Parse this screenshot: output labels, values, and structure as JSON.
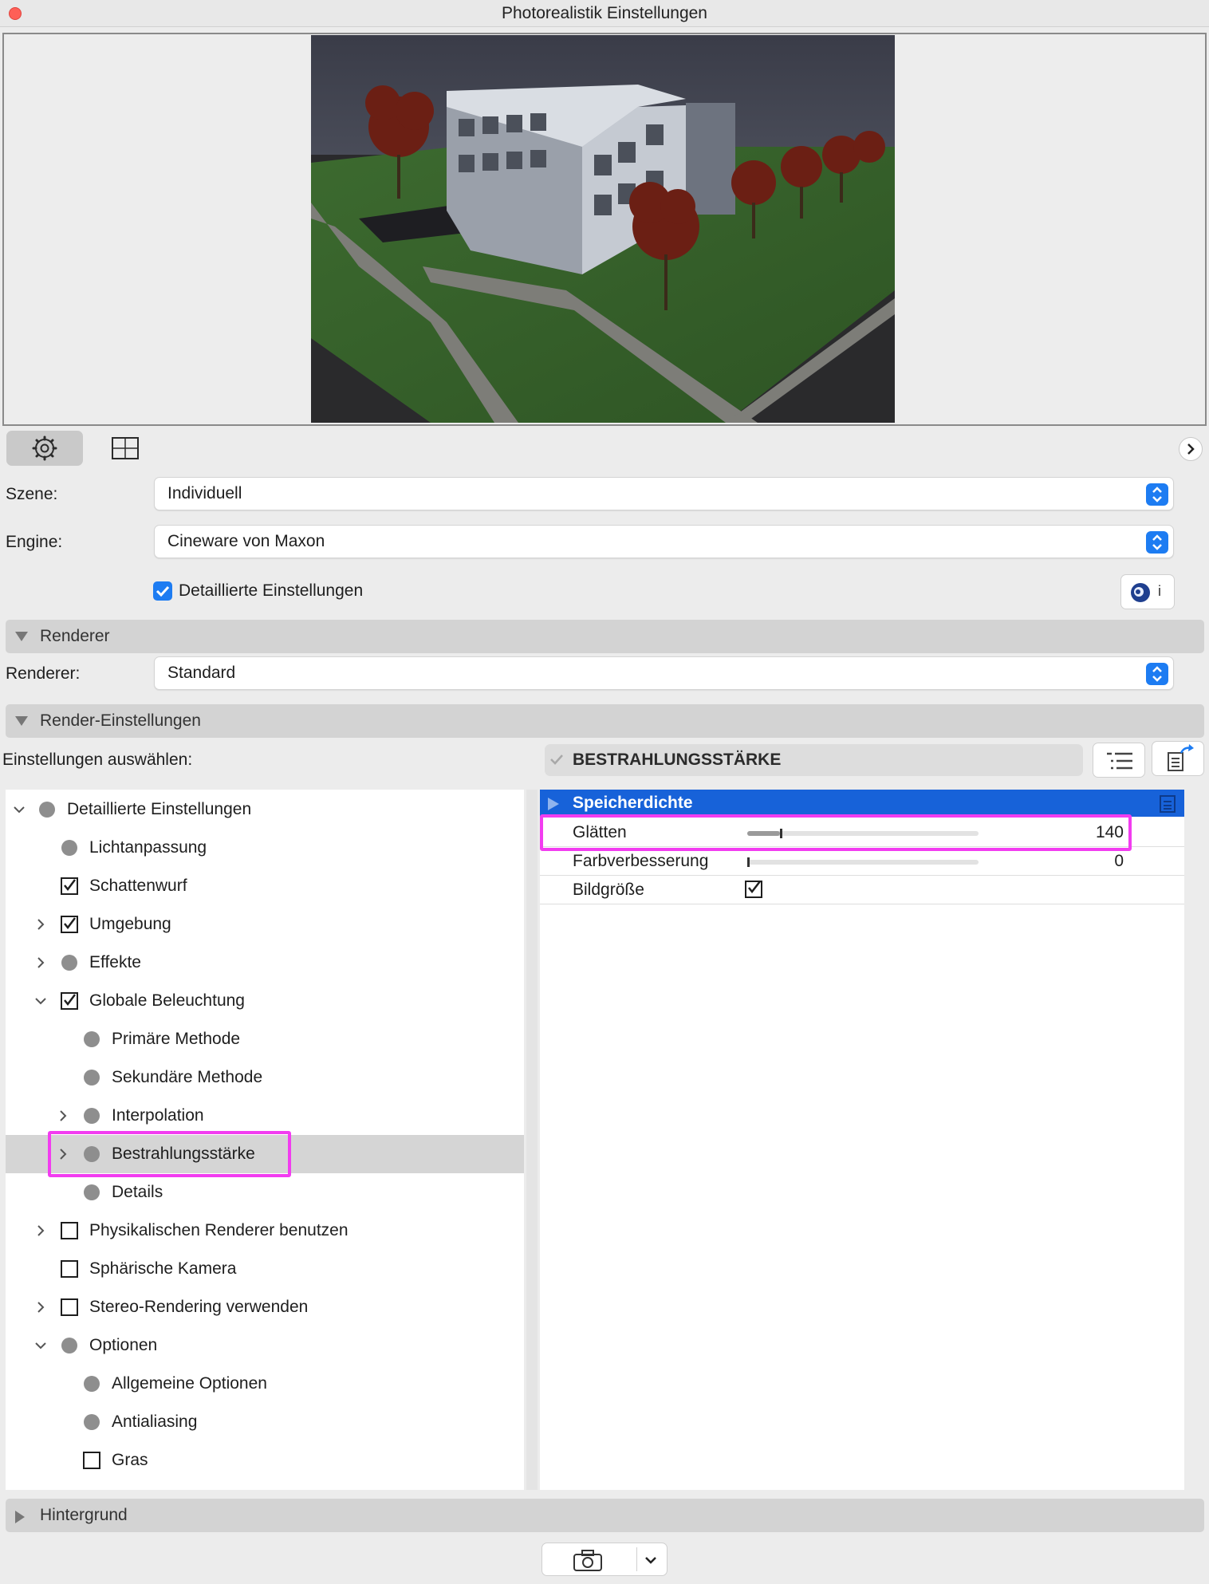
{
  "window": {
    "title": "Photorealistik Einstellungen"
  },
  "form": {
    "scene_label": "Szene:",
    "scene_value": "Individuell",
    "engine_label": "Engine:",
    "engine_value": "Cineware von Maxon",
    "detailed_label": "Detaillierte Einstellungen",
    "detailed_checked": true,
    "info_badge": "i"
  },
  "sections": {
    "renderer": "Renderer",
    "renderer_label": "Renderer:",
    "renderer_value": "Standard",
    "render_settings": "Render-Einstellungen",
    "select_label": "Einstellungen auswählen:",
    "preset": "BESTRAHLUNGSSTÄRKE",
    "background": "Hintergrund"
  },
  "tree": [
    {
      "label": "Detaillierte Einstellungen",
      "marker": "bullet",
      "chevron": "down"
    },
    {
      "label": "Lichtanpassung",
      "marker": "bullet",
      "chevron": "none"
    },
    {
      "label": "Schattenwurf",
      "marker": "checked",
      "chevron": "none"
    },
    {
      "label": "Umgebung",
      "marker": "checked",
      "chevron": "right"
    },
    {
      "label": "Effekte",
      "marker": "bullet",
      "chevron": "right"
    },
    {
      "label": "Globale Beleuchtung",
      "marker": "checked",
      "chevron": "down"
    },
    {
      "label": "Primäre Methode",
      "marker": "bullet",
      "chevron": "none"
    },
    {
      "label": "Sekundäre Methode",
      "marker": "bullet",
      "chevron": "none"
    },
    {
      "label": "Interpolation",
      "marker": "bullet",
      "chevron": "right"
    },
    {
      "label": "Bestrahlungsstärke",
      "marker": "bullet",
      "chevron": "right",
      "selected": true
    },
    {
      "label": "Details",
      "marker": "bullet",
      "chevron": "none"
    },
    {
      "label": "Physikalischen Renderer benutzen",
      "marker": "unchecked",
      "chevron": "right"
    },
    {
      "label": "Sphärische Kamera",
      "marker": "unchecked",
      "chevron": "none"
    },
    {
      "label": "Stereo-Rendering verwenden",
      "marker": "unchecked",
      "chevron": "right"
    },
    {
      "label": "Optionen",
      "marker": "bullet",
      "chevron": "down"
    },
    {
      "label": "Allgemeine Optionen",
      "marker": "bullet",
      "chevron": "none"
    },
    {
      "label": "Antialiasing",
      "marker": "bullet",
      "chevron": "none"
    },
    {
      "label": "Gras",
      "marker": "unchecked",
      "chevron": "none"
    }
  ],
  "params": {
    "group": "Speicherdichte",
    "rows": [
      {
        "label": "Glätten",
        "value": "140",
        "fraction": 0.14
      },
      {
        "label": "Farbverbesserung",
        "value": "0",
        "fraction": 0.0
      },
      {
        "label": "Bildgröße",
        "checked": true
      }
    ]
  },
  "colors": {
    "accent": "#1d7cf2",
    "selection_header": "#1762d9",
    "annotation": "#f23cf0"
  }
}
